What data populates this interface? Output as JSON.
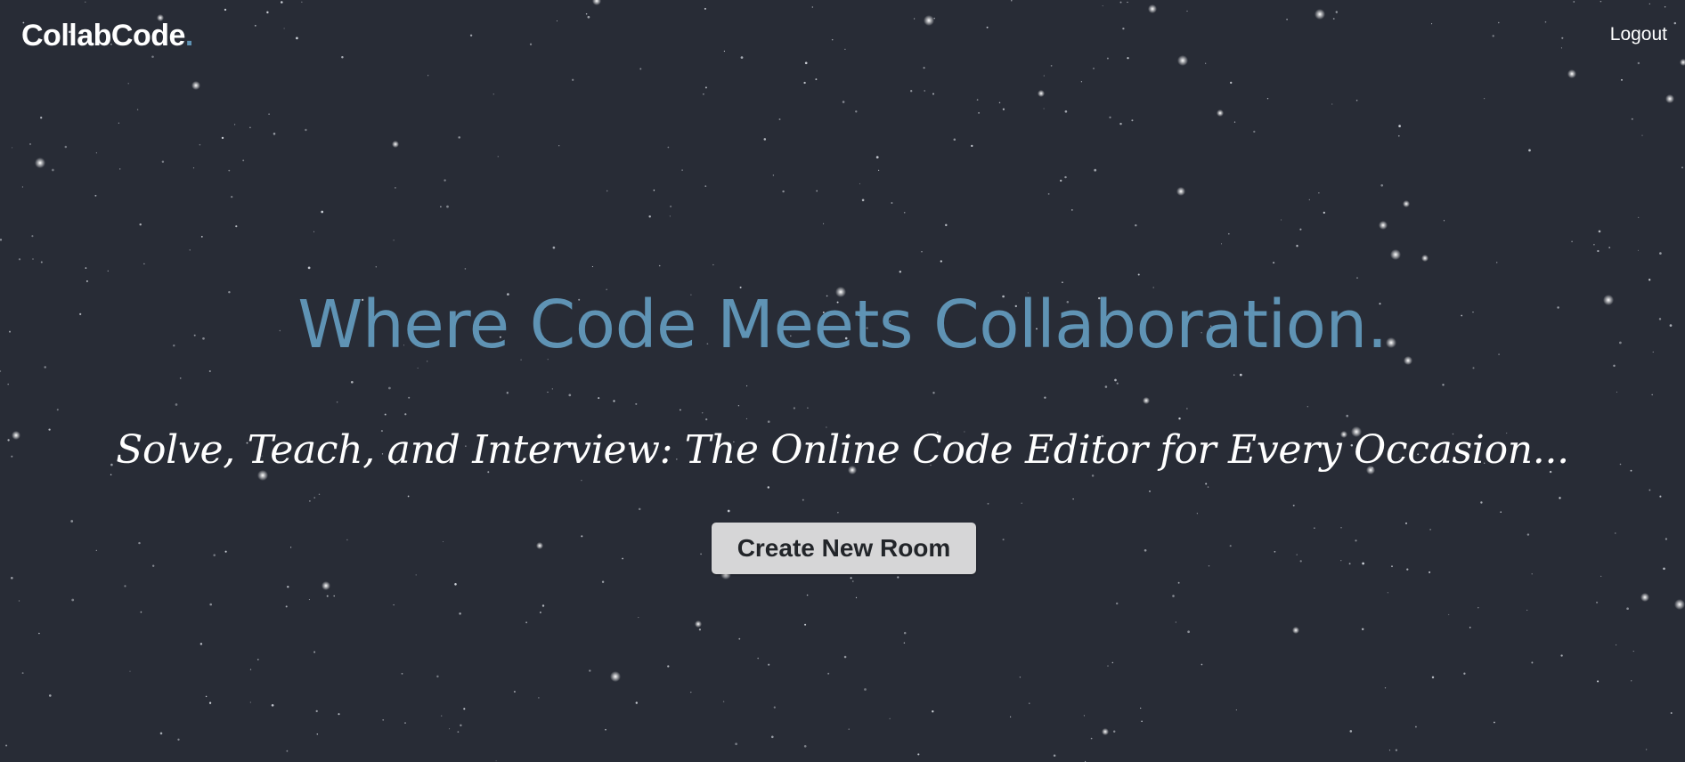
{
  "header": {
    "logo_text": "CollabCode",
    "logo_dot": ".",
    "logout_label": "Logout"
  },
  "hero": {
    "headline": "Where Code Meets Collaboration.",
    "subheadline": "Solve, Teach, and Interview: The Online Code Editor for Every Occasion...",
    "create_room_label": "Create New Room"
  },
  "colors": {
    "background": "#282c36",
    "accent": "#5f93b4",
    "button_bg": "#d6d6d7",
    "text": "#ffffff"
  }
}
